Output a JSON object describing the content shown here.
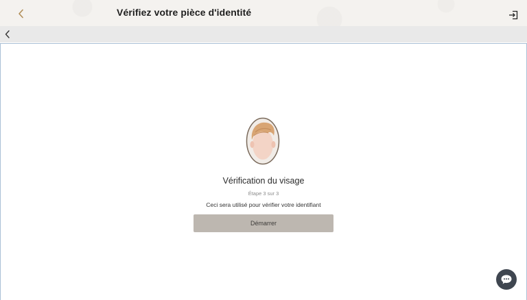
{
  "header": {
    "title": "Vérifiez votre pièce d'identité",
    "back_icon": "chevron-left-icon",
    "logout_icon": "logout-icon"
  },
  "subnav": {
    "back_icon": "chevron-left-icon"
  },
  "main": {
    "illustration": "face-avatar-illustration",
    "heading": "Vérification du visage",
    "step": "Étape 3 sur 3",
    "description": "Ceci sera utilisé pour vérifier votre identifiant",
    "start_label": "Démarrer"
  },
  "chat": {
    "icon": "chat-bubble-icon"
  },
  "colors": {
    "accent_gold": "#b08d57",
    "button_bg": "#bdb7b0",
    "chat_bg": "#3f4650"
  }
}
